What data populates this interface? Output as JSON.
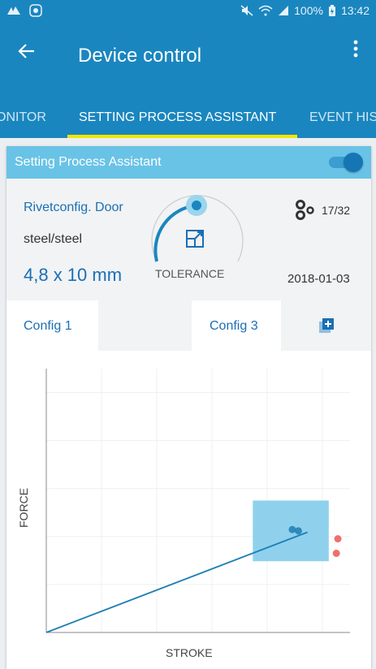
{
  "status_bar": {
    "battery": "100%",
    "time": "13:42",
    "icons": [
      "carrier-icon",
      "notification-icon",
      "mute-icon",
      "wifi-icon",
      "signal-icon",
      "battery-icon"
    ]
  },
  "app_bar": {
    "title": "Device control",
    "back_icon": "arrow-left-icon",
    "menu_icon": "more-vertical-icon"
  },
  "tabs": [
    {
      "label": "ONITOR",
      "active": false
    },
    {
      "label": "SETTING PROCESS ASSISTANT",
      "active": true
    },
    {
      "label": "EVENT HIS",
      "active": false
    }
  ],
  "card": {
    "header_label": "Setting Process Assistant",
    "toggle_on": true,
    "rivet_name": "Rivetconfig. Door",
    "material": "steel/steel",
    "size": "4,8 x 10 mm",
    "tolerance_label": "TOLERANCE",
    "count": "17/32",
    "date": "2018-01-03"
  },
  "configs": [
    {
      "label": "Config 1"
    },
    {
      "label": ""
    },
    {
      "label": "Config 3"
    }
  ],
  "colors": {
    "primary": "#1a86bf",
    "accent_tab": "#f4e600",
    "header_light": "#69c3e6",
    "text_blue": "#1a6fb5",
    "tolerance_box": "#8fd1ec",
    "line": "#1f7fb3",
    "outlier": "#ef6f6c"
  },
  "chart_data": {
    "type": "line",
    "xlabel": "STROKE",
    "ylabel": "FORCE",
    "grid": true,
    "series": [
      {
        "values": [
          [
            0,
            0
          ],
          [
            0.86,
            0.38
          ]
        ]
      }
    ],
    "tolerance_box": {
      "x": [
        0.68,
        0.93
      ],
      "y": [
        0.27,
        0.5
      ]
    },
    "points": [
      {
        "x": 0.81,
        "y": 0.39,
        "kind": "in-tolerance"
      },
      {
        "x": 0.83,
        "y": 0.385,
        "kind": "in-tolerance"
      },
      {
        "x": 0.96,
        "y": 0.355,
        "kind": "outlier"
      },
      {
        "x": 0.955,
        "y": 0.3,
        "kind": "outlier"
      }
    ]
  }
}
